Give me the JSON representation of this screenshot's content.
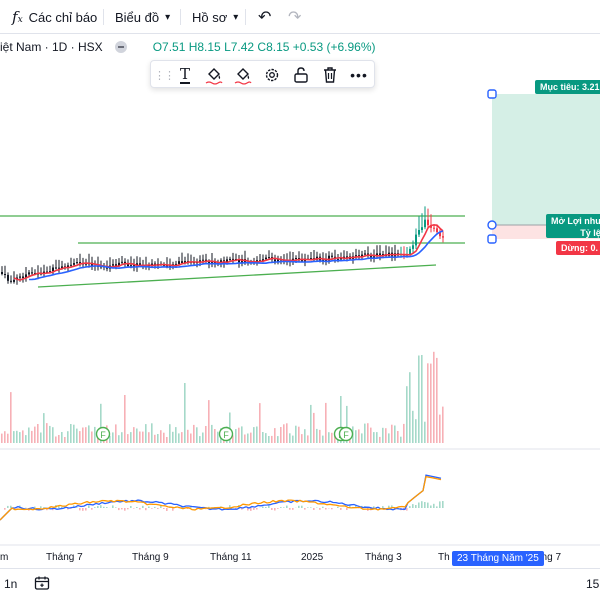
{
  "toolbar": {
    "indicators_label": "Các chỉ báo",
    "chart_type_label": "Biểu đồ",
    "profile_label": "Hồ sơ"
  },
  "legend": {
    "symbol_text": "iệt Nam · 1D · HSX",
    "ohlc_text": "O7.51  H8.15  L7.42  C8.15  +0.53 (+6.96%)"
  },
  "position_tool": {
    "target_label": "Mục tiêu: 3.21",
    "open_pnl_label": "Mở Lợi nhu",
    "ratio_label": "Tỷ lệ",
    "stop_label": "Dừng: 0."
  },
  "time_axis": {
    "labels": [
      "m",
      "Tháng 7",
      "Tháng 9",
      "Tháng 11",
      "2025",
      "Tháng 3",
      "Th",
      "áng 7"
    ],
    "crosshair_date": "23 Tháng Năm '25"
  },
  "bottom_bar": {
    "range_label": "1n",
    "right_value": "15"
  },
  "colors": {
    "up": "#089981",
    "down": "#f23645",
    "ma_red": "#f23645",
    "ma_blue": "#2962ff",
    "trendline": "#4caf50",
    "target_zone": "#d5efe6",
    "stop_zone": "#fde3e3",
    "target_tag": "#089981",
    "stop_tag": "#f23645",
    "date_tag": "#2962ff"
  }
}
